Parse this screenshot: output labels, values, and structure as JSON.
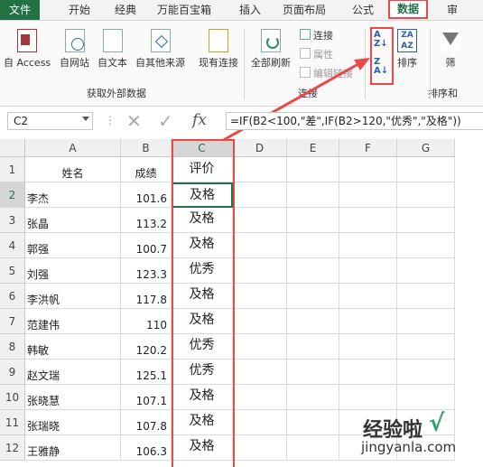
{
  "menu": [
    "文件",
    "开始",
    "经典",
    "万能百宝箱",
    "插入",
    "页面布局",
    "公式",
    "数据",
    "审"
  ],
  "ribbon": {
    "external": [
      "自 Access",
      "自网站",
      "自文本",
      "自其他来源",
      "现有连接"
    ],
    "external_group": "获取外部数据",
    "refresh": "全部刷新",
    "connections": [
      "连接",
      "属性",
      "编辑链接"
    ],
    "connections_group": "连接",
    "sort_label": "排序",
    "sort_group": "排序和",
    "filter": "筛"
  },
  "formula_bar": {
    "cell_ref": "C2",
    "formula": "=IF(B2<100,\"差\",IF(B2>120,\"优秀\",\"及格\"))",
    "fx": "fx"
  },
  "columns": [
    "A",
    "B",
    "C",
    "D",
    "E",
    "F",
    "G"
  ],
  "headers": {
    "name": "姓名",
    "score": "成绩",
    "eval": "评价"
  },
  "rows": [
    {
      "num": "2",
      "name": "李杰",
      "score": "101.6",
      "eval": "及格"
    },
    {
      "num": "3",
      "name": "张晶",
      "score": "113.2",
      "eval": "及格"
    },
    {
      "num": "4",
      "name": "郭强",
      "score": "100.7",
      "eval": "及格"
    },
    {
      "num": "5",
      "name": "刘强",
      "score": "123.3",
      "eval": "优秀"
    },
    {
      "num": "6",
      "name": "李洪帆",
      "score": "117.8",
      "eval": "及格"
    },
    {
      "num": "7",
      "name": "范建伟",
      "score": "110",
      "eval": "及格"
    },
    {
      "num": "8",
      "name": "韩敏",
      "score": "120.2",
      "eval": "优秀"
    },
    {
      "num": "9",
      "name": "赵文瑞",
      "score": "125.1",
      "eval": "优秀"
    },
    {
      "num": "10",
      "name": "张晓慧",
      "score": "107.1",
      "eval": "及格"
    },
    {
      "num": "11",
      "name": "张瑞晓",
      "score": "107.8",
      "eval": "及格"
    },
    {
      "num": "12",
      "name": "王雅静",
      "score": "106.3",
      "eval": "及格"
    }
  ],
  "watermark": {
    "text": "经验啦",
    "url": "jingyanla.com"
  },
  "colors": {
    "excel_green": "#217346",
    "highlight_red": "#e84a4a"
  }
}
